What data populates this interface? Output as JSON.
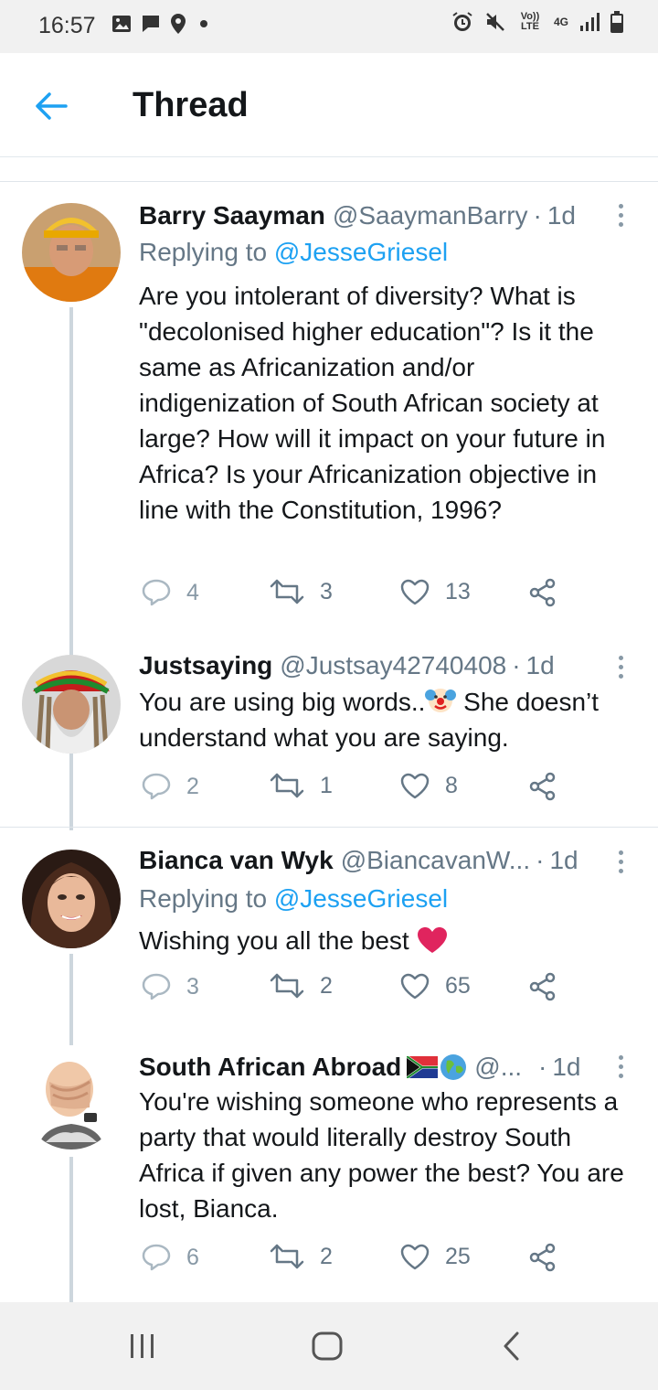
{
  "status_bar": {
    "time": "16:57",
    "left_icons": [
      "image-icon",
      "message-icon",
      "location-icon",
      "dot-icon"
    ],
    "right_icons": [
      "alarm-icon",
      "mute-icon",
      "volte-icon",
      "4g-icon",
      "signal-icon",
      "battery-icon"
    ],
    "volte_label": "Vo)) LTE",
    "network_label": "4G"
  },
  "header": {
    "title": "Thread",
    "back_icon": "back-arrow-icon"
  },
  "tweets": [
    {
      "name": "Barry Saayman",
      "handle": "@SaaymanBarry",
      "dot": "·",
      "time": "1d",
      "replying_prefix": "Replying to",
      "replying_to": "@JesseGriesel",
      "text": "Are you intolerant of diversity? What is \"decolonised higher education\"?  Is it the same as Africanization and/or indigenization of South African society at large? How will it impact on your future in Africa? Is your Africanization objective in line with the Constitution, 1996?",
      "replies": "4",
      "retweets": "3",
      "likes": "13"
    },
    {
      "name": "Justsaying",
      "handle": "@Justsay42740408",
      "dot": "·",
      "time": "1d",
      "text_before": "You are using big words..",
      "text_after": " She doesn’t understand what you are saying.",
      "emoji": "clown-face-emoji",
      "replies": "2",
      "retweets": "1",
      "likes": "8"
    },
    {
      "name": "Bianca van Wyk",
      "handle": "@BiancavanW...",
      "dot": "·",
      "time": "1d",
      "replying_prefix": "Replying to",
      "replying_to": "@JesseGriesel",
      "text": "Wishing you all the best ",
      "emoji": "red-heart-emoji",
      "replies": "3",
      "retweets": "2",
      "likes": "65"
    },
    {
      "name": "South African Abroad",
      "name_emojis": [
        "south-africa-flag-emoji",
        "globe-emoji"
      ],
      "handle": "@...",
      "dot": "·",
      "time": "1d",
      "text": "You're wishing someone who represents a party that would literally destroy South Africa if given any power the best? You are lost, Bianca.",
      "replies": "6",
      "retweets": "2",
      "likes": "25"
    }
  ],
  "colors": {
    "accent": "#1da1f2",
    "secondary_text": "#657786",
    "action_icon": "#8899a6",
    "thread_line": "#cdd6dd",
    "heart": "#e0245e"
  },
  "nav_bar": {
    "buttons": [
      "recent-apps-icon",
      "home-icon",
      "back-icon"
    ]
  }
}
